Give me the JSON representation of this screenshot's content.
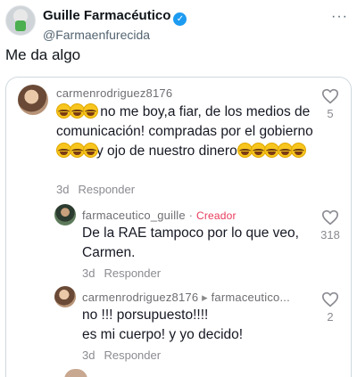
{
  "tweet": {
    "display_name": "Guille Farmacéutico",
    "verified_icon": "✓",
    "handle": "@Farmaenfurecida",
    "more": "···",
    "text": "Me da algo"
  },
  "comments": [
    {
      "username": "carmenrodriguez8176",
      "text_part1": " no me boy,a fiar, de los medios de comunicación! compradas por el gobierno",
      "text_part2": "y ojo de nuestro dinero",
      "time": "3d",
      "reply": "Responder",
      "likes": "5"
    },
    {
      "username": "farmaceutico_guille",
      "separator": " · ",
      "badge": "Creador",
      "text": "De la RAE tampoco por lo que veo, Carmen.",
      "time": "3d",
      "reply": "Responder",
      "likes": "318"
    },
    {
      "username": "carmenrodriguez8176",
      "reply_arrow": " ▸ ",
      "reply_to": "farmaceutico...",
      "text_line1": "no !!! porsupuesto!!!!",
      "text_line2": "es mi cuerpo! y yo decido!",
      "time": "3d",
      "reply": "Responder",
      "likes": "2"
    }
  ],
  "icons": {
    "emoji": "face-with-tears-of-joy",
    "like": "heart-outline",
    "more": "more-horizontal"
  }
}
